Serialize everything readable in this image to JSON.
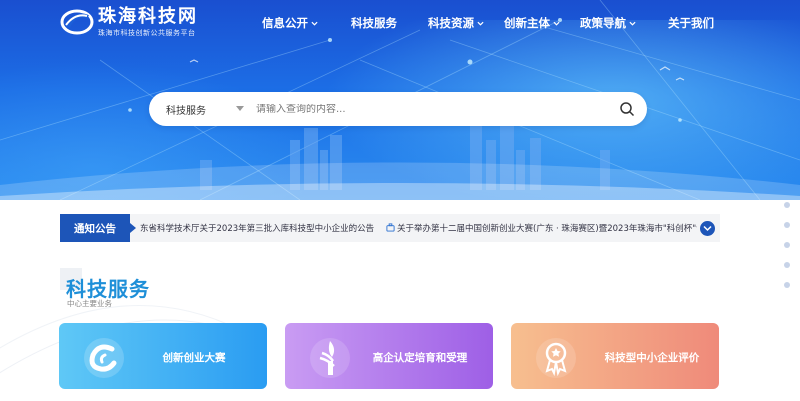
{
  "site": {
    "title": "珠海科技网",
    "subtitle": "珠海市科技创新公共服务平台"
  },
  "nav": {
    "items": [
      {
        "label": "信息公开",
        "dropdown": true
      },
      {
        "label": "科技服务",
        "dropdown": false
      },
      {
        "label": "科技资源",
        "dropdown": true
      },
      {
        "label": "创新主体",
        "dropdown": true
      },
      {
        "label": "政策导航",
        "dropdown": true
      },
      {
        "label": "关于我们",
        "dropdown": false
      }
    ]
  },
  "search": {
    "category": "科技服务",
    "placeholder": "请输入查询的内容..."
  },
  "notice": {
    "label": "通知公告",
    "items": [
      "东省科学技术厅关于2023年第三批入库科技型中小企业的公告",
      "关于举办第十二届中国创新创业大赛(广东 · 珠海赛区)暨2023年珠海市\"科创杯\"创新"
    ]
  },
  "section": {
    "title": "科技服务",
    "subtitle": "中心主要业务"
  },
  "cards": [
    {
      "label": "创新创业大赛",
      "icon": "c-logo-icon"
    },
    {
      "label": "高企认定培育和受理",
      "icon": "torch-icon"
    },
    {
      "label": "科技型中小企业评价",
      "icon": "award-medal-icon"
    }
  ],
  "colors": {
    "primary": "#1d55b8",
    "accent_title": "#1e8fd8",
    "card1": "#2a9cf2",
    "card2": "#9e5fe6",
    "card3": "#ef8a7a"
  }
}
